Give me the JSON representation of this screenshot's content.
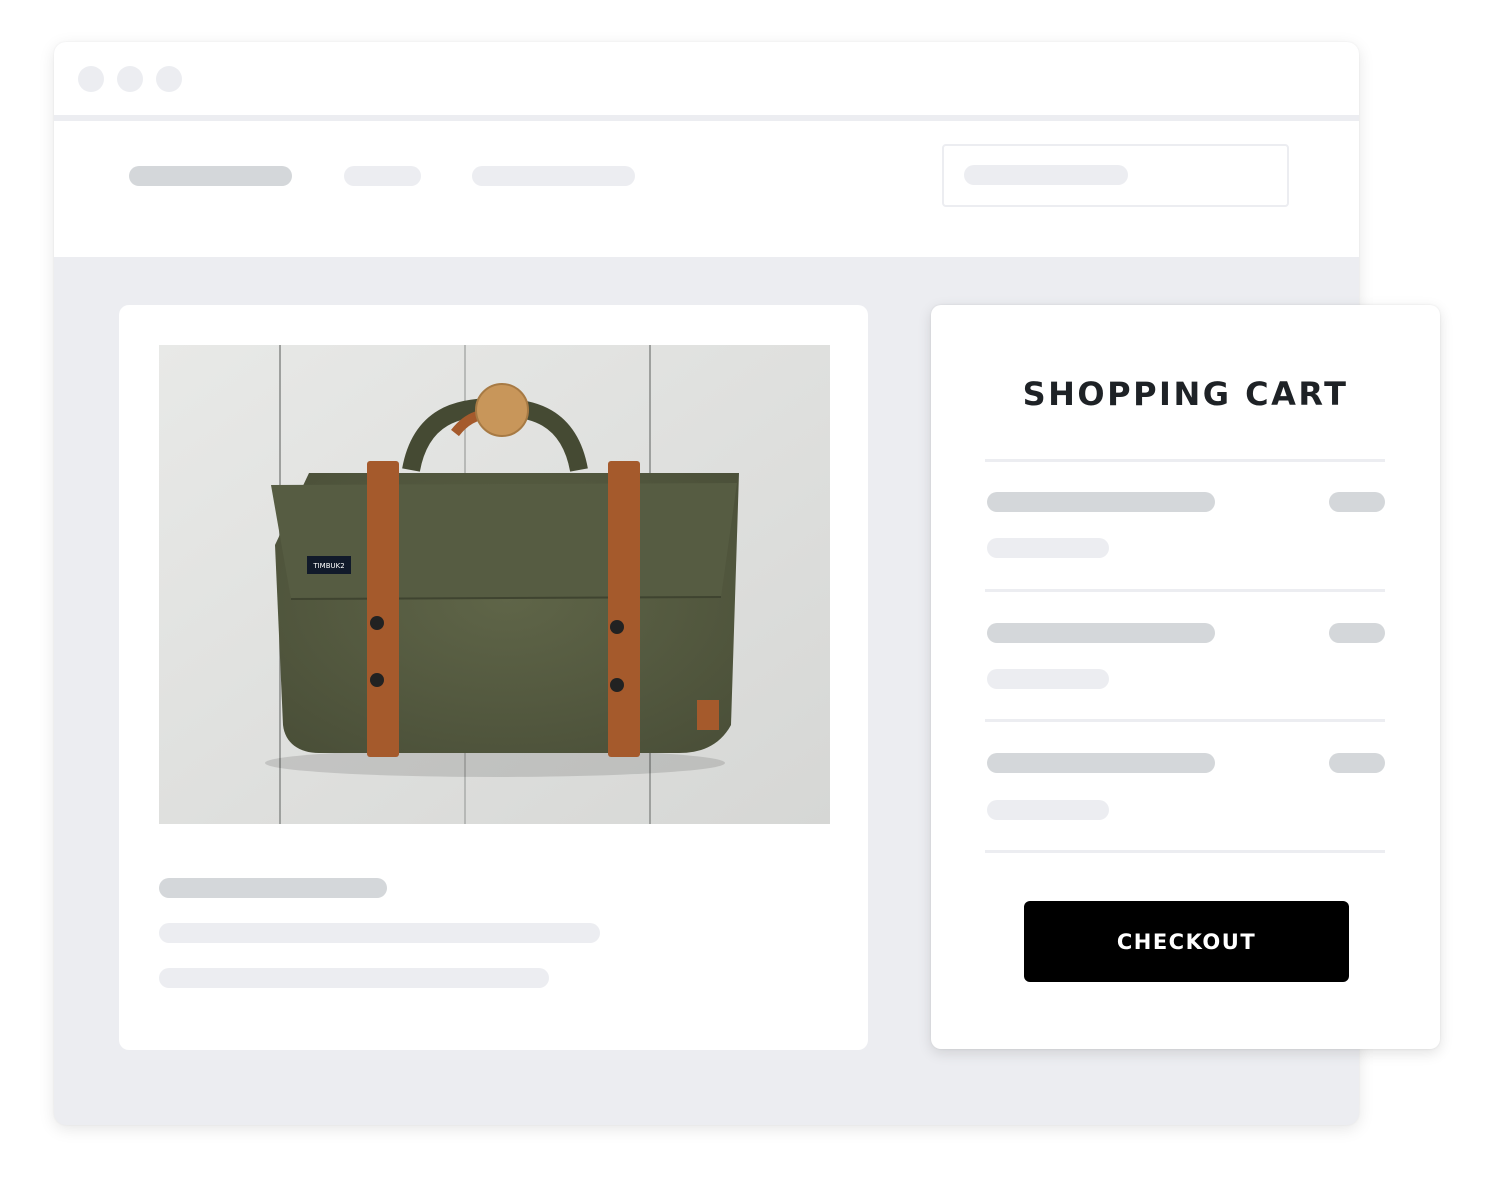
{
  "window": {
    "controls": [
      "close",
      "minimize",
      "maximize"
    ]
  },
  "navbar": {
    "logo_placeholder": "",
    "links": [
      "",
      ""
    ],
    "search": {
      "placeholder": ""
    }
  },
  "product": {
    "image_alt": "Olive green canvas messenger bag with brown leather straps hanging on a wooden peg",
    "brand_label": "TIMBUK2",
    "colors": {
      "canvas": "#5a5f45",
      "leather": "#a55a2c",
      "wood_wall": "#e4e5e3",
      "peg": "#c8965a"
    }
  },
  "cart": {
    "title": "SHOPPING CART",
    "items": [
      {
        "name": "",
        "price": "",
        "detail": ""
      },
      {
        "name": "",
        "price": "",
        "detail": ""
      },
      {
        "name": "",
        "price": "",
        "detail": ""
      }
    ],
    "checkout_label": "CHECKOUT",
    "checkout_color": "#000000"
  },
  "placeholder_colors": {
    "dark": "#d4d7da",
    "light": "#ecedf1",
    "background": "#ecedf1"
  }
}
